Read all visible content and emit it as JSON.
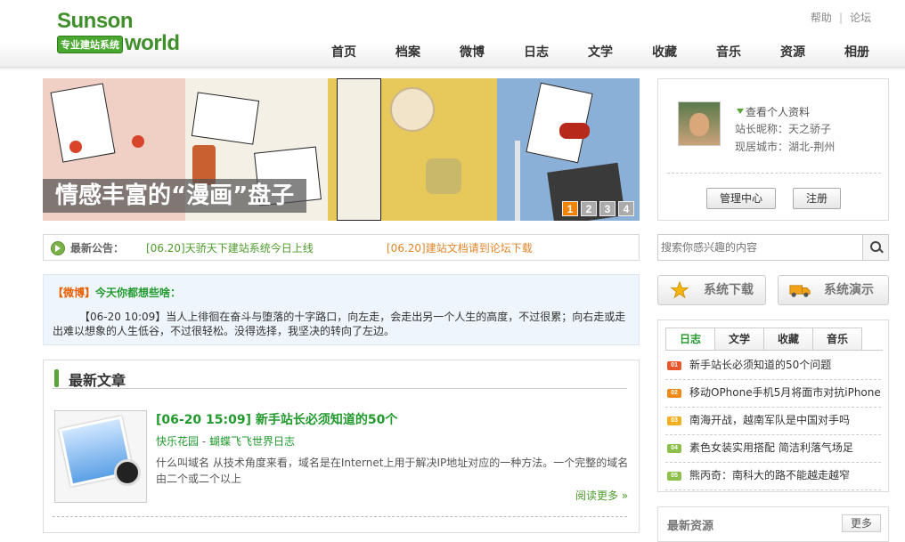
{
  "logo": {
    "line1": "Sunson",
    "line2": "专业建站系统",
    "line3": "world"
  },
  "toplinks": {
    "help": "帮助",
    "sep": "|",
    "forum": "论坛"
  },
  "nav": [
    "首页",
    "档案",
    "微博",
    "日志",
    "文学",
    "收藏",
    "音乐",
    "资源",
    "相册"
  ],
  "banner": {
    "caption": "情感丰富的“漫画”盘子",
    "pages": [
      "1",
      "2",
      "3",
      "4"
    ],
    "active": 0
  },
  "notice": {
    "label": "最新公告：",
    "item1": "[06.20]天骄天下建站系统今日上线",
    "item2": "[06.20]建站文档请到论坛下载"
  },
  "weibo": {
    "bracket": "【微博】",
    "title": "今天你都想些啥：",
    "content": "【06-20 10:09】当人上徘徊在奋斗与堕落的十字路口，向左走，会走出另一个人生的高度，不过很累；向右走或走出难以想象的人生低谷，不过很轻松。没得选择，我坚决的转向了左边。"
  },
  "latest": {
    "heading": "最新文章",
    "article": {
      "title": "[06-20 15:09] 新手站长必须知道的50个",
      "category": "快乐花园",
      "sep": " - ",
      "author": "蝴蝶飞飞世界日志",
      "desc": "什么叫域名 从技术角度来看，域名是在Internet上用于解决IP地址对应的一种方法。一个完整的域名由二个或二个以上",
      "more": "阅读更多 »"
    }
  },
  "profile": {
    "view": "查看个人资料",
    "nickname": "站长昵称：天之骄子",
    "city": "现居城市：湖北-荆州",
    "admin_btn": "管理中心",
    "register_btn": "注册"
  },
  "search": {
    "placeholder": "搜索你感兴趣的内容"
  },
  "buttons": {
    "download": "系统下载",
    "demo": "系统演示"
  },
  "tabs": {
    "items": [
      "日志",
      "文学",
      "收藏",
      "音乐"
    ],
    "active": 0,
    "list": [
      {
        "num": "01",
        "color": "#e8552b",
        "text": "新手站长必须知道的50个问题"
      },
      {
        "num": "02",
        "color": "#f08a16",
        "text": "移动OPhone手机5月将面市对抗iPhone"
      },
      {
        "num": "03",
        "color": "#f0b020",
        "text": "南海开战，越南军队是中国对手吗"
      },
      {
        "num": "04",
        "color": "#8cc04a",
        "text": "素色女装实用搭配 简洁利落气场足"
      },
      {
        "num": "05",
        "color": "#8cc04a",
        "text": "熊丙奇：南科大的路不能越走越窄"
      }
    ]
  },
  "resources": {
    "title": "最新资源",
    "more": "更多"
  }
}
